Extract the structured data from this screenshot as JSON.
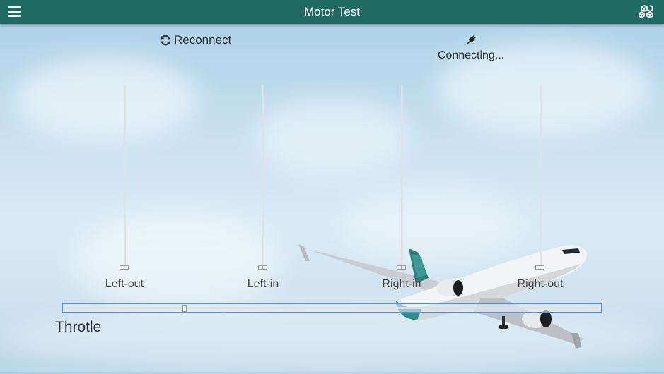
{
  "app": {
    "title": "Motor Test",
    "menu_icon": "hamburger-menu-icon",
    "action_icon": "cubes-icon",
    "bar_color": "#216a62"
  },
  "connection": {
    "reconnect_label": "Reconnect",
    "reconnect_icon": "refresh-icon",
    "status_icon": "plug-icon",
    "status_text": "Connecting..."
  },
  "motors": [
    {
      "label": "Left-out",
      "value": 0
    },
    {
      "label": "Left-in",
      "value": 0
    },
    {
      "label": "Right-in",
      "value": 0
    },
    {
      "label": "Right-out",
      "value": 0
    }
  ],
  "throttle": {
    "label": "Throtle",
    "value": 0.224
  }
}
